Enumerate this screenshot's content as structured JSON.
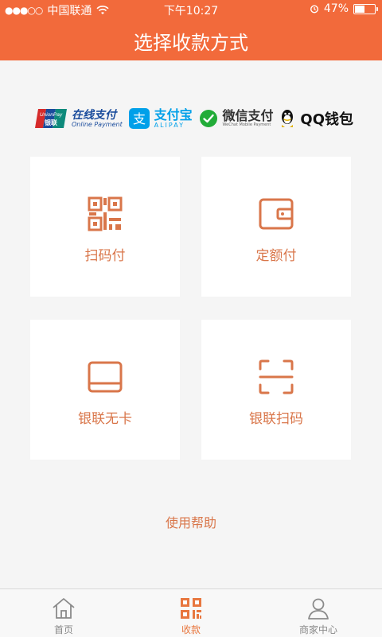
{
  "status_bar": {
    "signal_dots": "●●●○○",
    "carrier": "中国联通",
    "wifi_icon": "wifi-icon",
    "time": "下午10:27",
    "alarm_icon": "alarm-icon",
    "battery_percent": "47%",
    "battery_level": 0.47
  },
  "header": {
    "title": "选择收款方式",
    "background": "#f26a3b"
  },
  "payment_logos": {
    "unionpay": {
      "badge_top": "UnionPay",
      "badge_bottom": "银联",
      "name": "在线支付",
      "sub": "Online Payment"
    },
    "alipay": {
      "name": "支付宝",
      "sub": "ALIPAY",
      "glyph": "支"
    },
    "wechat": {
      "name": "微信支付",
      "sub": "WeChat Mobile Payment"
    },
    "qq": {
      "name": "QQ钱包"
    }
  },
  "tiles": [
    {
      "label": "扫码付",
      "icon": "qrcode-icon"
    },
    {
      "label": "定额付",
      "icon": "wallet-icon"
    },
    {
      "label": "银联无卡",
      "icon": "card-icon"
    },
    {
      "label": "银联扫码",
      "icon": "scan-icon"
    }
  ],
  "help_link": "使用帮助",
  "tabbar": {
    "items": [
      {
        "label": "首页",
        "icon": "home-icon"
      },
      {
        "label": "收款",
        "icon": "qrcode-icon",
        "active": true
      },
      {
        "label": "商家中心",
        "icon": "user-icon"
      }
    ]
  },
  "colors": {
    "accent": "#d9764a",
    "active_tab": "#e8773f"
  }
}
